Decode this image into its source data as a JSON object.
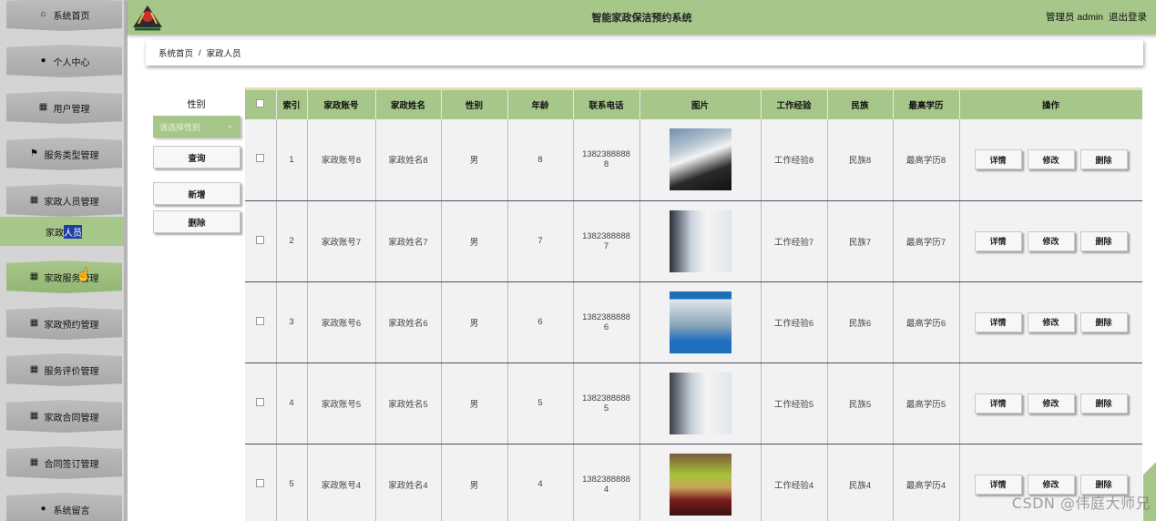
{
  "header": {
    "title": "智能家政保洁预约系统",
    "user": "管理员 admin",
    "logout": "退出登录"
  },
  "sidebar": {
    "items": [
      {
        "label": "系统首页",
        "icon": "home-icon"
      },
      {
        "label": "个人中心",
        "icon": "user-icon"
      },
      {
        "label": "用户管理",
        "icon": "grid-icon"
      },
      {
        "label": "服务类型管理",
        "icon": "flag-icon"
      },
      {
        "label": "家政人员管理",
        "icon": "grid-icon"
      },
      {
        "label": "家政服务管理",
        "icon": "grid-icon"
      },
      {
        "label": "家政预约管理",
        "icon": "grid-icon"
      },
      {
        "label": "服务评价管理",
        "icon": "grid-icon"
      },
      {
        "label": "家政合同管理",
        "icon": "grid-icon"
      },
      {
        "label": "合同签订管理",
        "icon": "grid-icon"
      },
      {
        "label": "系统留言",
        "icon": "user-icon"
      }
    ],
    "sub_item": {
      "prefix": "家政",
      "highlight": "人员"
    }
  },
  "breadcrumb": {
    "home": "系统首页",
    "separator": "/",
    "current": "家政人员"
  },
  "filter": {
    "label": "性别",
    "placeholder": "请选择性别",
    "search": "查询",
    "add": "新增",
    "delete": "删除"
  },
  "table": {
    "headers": [
      "索引",
      "家政账号",
      "家政姓名",
      "性别",
      "年龄",
      "联系电话",
      "图片",
      "工作经验",
      "民族",
      "最高学历",
      "操作"
    ],
    "ops": [
      "详情",
      "修改",
      "删除"
    ],
    "rows": [
      {
        "index": "1",
        "account": "家政账号8",
        "name": "家政姓名8",
        "gender": "男",
        "age": "8",
        "phone": "13823888888",
        "experience": "工作经验8",
        "ethnicity": "民族8",
        "education": "最高学历8"
      },
      {
        "index": "2",
        "account": "家政账号7",
        "name": "家政姓名7",
        "gender": "男",
        "age": "7",
        "phone": "13823888887",
        "experience": "工作经验7",
        "ethnicity": "民族7",
        "education": "最高学历7"
      },
      {
        "index": "3",
        "account": "家政账号6",
        "name": "家政姓名6",
        "gender": "男",
        "age": "6",
        "phone": "13823888886",
        "experience": "工作经验6",
        "ethnicity": "民族6",
        "education": "最高学历6"
      },
      {
        "index": "4",
        "account": "家政账号5",
        "name": "家政姓名5",
        "gender": "男",
        "age": "5",
        "phone": "13823888885",
        "experience": "工作经验5",
        "ethnicity": "民族5",
        "education": "最高学历5"
      },
      {
        "index": "5",
        "account": "家政账号4",
        "name": "家政姓名4",
        "gender": "男",
        "age": "4",
        "phone": "13823888884",
        "experience": "工作经验4",
        "ethnicity": "民族4",
        "education": "最高学历4"
      }
    ]
  },
  "watermark": "CSDN @伟庭大师兄",
  "colors": {
    "accent": "#a7c68a",
    "sidebar": "#d4d4d4",
    "menu": "#b3b3b3",
    "selection": "#1d3fa6"
  }
}
